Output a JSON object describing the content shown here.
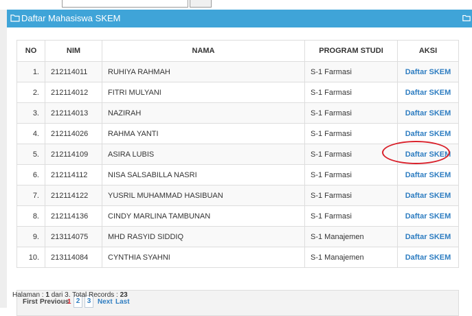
{
  "panel": {
    "title": "Daftar Mahasiswa SKEM",
    "header_color": "#3fa4d8"
  },
  "table": {
    "columns": [
      "NO",
      "NIM",
      "NAMA",
      "PROGRAM STUDI",
      "AKSI"
    ],
    "rows": [
      {
        "no": "1.",
        "nim": "212114011",
        "nama": "RUHIYA RAHMAH",
        "prodi": "S-1 Farmasi",
        "aksi": "Daftar SKEM"
      },
      {
        "no": "2.",
        "nim": "212114012",
        "nama": "FITRI MULYANI",
        "prodi": "S-1 Farmasi",
        "aksi": "Daftar SKEM"
      },
      {
        "no": "3.",
        "nim": "212114013",
        "nama": "NAZIRAH",
        "prodi": "S-1 Farmasi",
        "aksi": "Daftar SKEM"
      },
      {
        "no": "4.",
        "nim": "212114026",
        "nama": "RAHMA YANTI",
        "prodi": "S-1 Farmasi",
        "aksi": "Daftar SKEM"
      },
      {
        "no": "5.",
        "nim": "212114109",
        "nama": "ASIRA LUBIS",
        "prodi": "S-1 Farmasi",
        "aksi": "Daftar SKEM"
      },
      {
        "no": "6.",
        "nim": "212114112",
        "nama": "NISA SALSABILLA NASRI",
        "prodi": "S-1 Farmasi",
        "aksi": "Daftar SKEM"
      },
      {
        "no": "7.",
        "nim": "212114122",
        "nama": "YUSRIL MUHAMMAD HASIBUAN",
        "prodi": "S-1 Farmasi",
        "aksi": "Daftar SKEM"
      },
      {
        "no": "8.",
        "nim": "212114136",
        "nama": "CINDY MARLINA TAMBUNAN",
        "prodi": "S-1 Farmasi",
        "aksi": "Daftar SKEM"
      },
      {
        "no": "9.",
        "nim": "213114075",
        "nama": "MHD RASYID SIDDIQ",
        "prodi": "S-1 Manajemen",
        "aksi": "Daftar SKEM"
      },
      {
        "no": "10.",
        "nim": "213114084",
        "nama": "CYNTHIA SYAHNI",
        "prodi": "S-1 Manajemen",
        "aksi": "Daftar SKEM"
      }
    ],
    "highlighted_row": 5,
    "link_color": "#2e7dc1"
  },
  "pager": {
    "first": "First",
    "previous": "Previous",
    "current": "1",
    "pages": [
      "2",
      "3"
    ],
    "next": "Next",
    "last": "Last"
  },
  "summary": {
    "page_label": "Halaman :",
    "page": "1",
    "of_label": "dari",
    "total_pages": "3.",
    "records_label": "Total Records :",
    "total_records": "23"
  }
}
